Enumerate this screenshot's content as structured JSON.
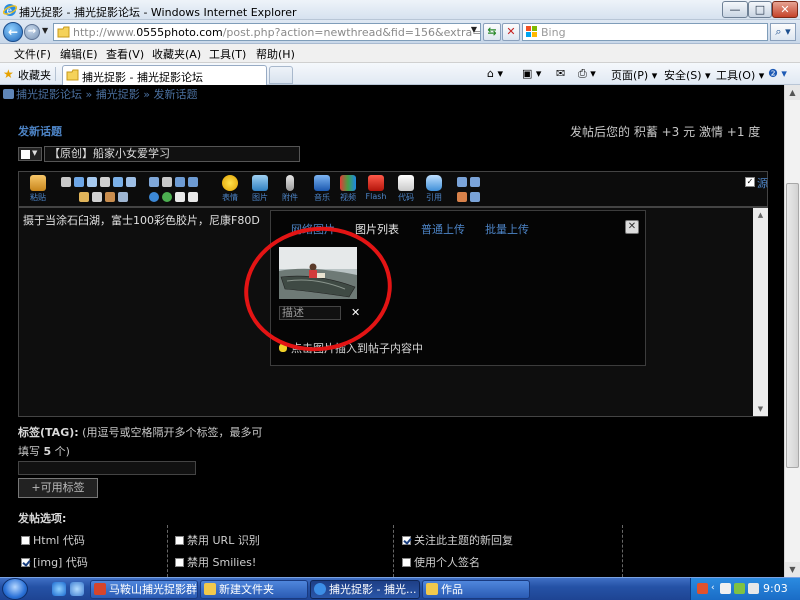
{
  "window": {
    "title": "捕光捉影 - 捕光捉影论坛 - Windows Internet Explorer",
    "min_glyph": "—",
    "max_glyph": "□",
    "close_glyph": "✕"
  },
  "address": {
    "url_prefix": "http://www.",
    "url_domain": "0555photo.com",
    "url_path": "/post.php?action=newthread&fid=156&extra=",
    "search_placeholder": "Bing"
  },
  "menu": [
    "文件(F)",
    "编辑(E)",
    "查看(V)",
    "收藏夹(A)",
    "工具(T)",
    "帮助(H)"
  ],
  "favorites": {
    "label": "收藏夹",
    "tab_title": "捕光捉影 - 捕光捉影论坛"
  },
  "command_bar": {
    "page": "页面(P) ▾",
    "safety": "安全(S) ▾",
    "tools": "工具(O) ▾",
    "help": "❷ ▾"
  },
  "page": {
    "breadcrumb": "捕光捉影论坛 » 捕光捉影 » 发新话题",
    "heading": "发新话题",
    "reward": "发帖后您的 积蓄 +3 元 激情 +1 度",
    "subject": "【原创】船家小女爱学习",
    "toolbar": {
      "paste": "粘贴",
      "emoticon": "表情",
      "image": "图片",
      "attachment": "附件",
      "music": "音乐",
      "video": "视频",
      "flash": "Flash",
      "code": "代码",
      "quote": "引用",
      "source": "源"
    },
    "editor_text": "摄于当涂石臼湖，富士100彩色胶片，尼康F80D",
    "image_panel": {
      "tabs": [
        "网络图片",
        "图片列表",
        "普通上传",
        "批量上传"
      ],
      "desc_placeholder": "描述",
      "hint": "点击图片插入到帖子内容中"
    },
    "tags": {
      "label": "标签(TAG):",
      "help_before": "(用逗号或空格隔开多个标签，最多可填写",
      "max": "5",
      "help_after": "个)",
      "button": "+可用标签"
    },
    "options": {
      "title": "发帖选项:",
      "items": [
        {
          "label": "Html 代码",
          "checked": false
        },
        {
          "label": "[img] 代码",
          "checked": true
        },
        {
          "label": "禁用 URL 识别",
          "checked": false
        },
        {
          "label": "禁用 Smilies!",
          "checked": false
        },
        {
          "label": "关注此主题的新回复",
          "checked": true
        },
        {
          "label": "使用个人签名",
          "checked": false
        }
      ]
    }
  },
  "taskbar": {
    "buttons": [
      "马鞍山捕光捉影群",
      "新建文件夹",
      "捕光捉影 - 捕光...",
      "作品"
    ],
    "clock": "9:03"
  },
  "colors": {
    "link_blue": "#4d84c6",
    "annotation_red": "#e31414",
    "page_bg": "#000000"
  }
}
